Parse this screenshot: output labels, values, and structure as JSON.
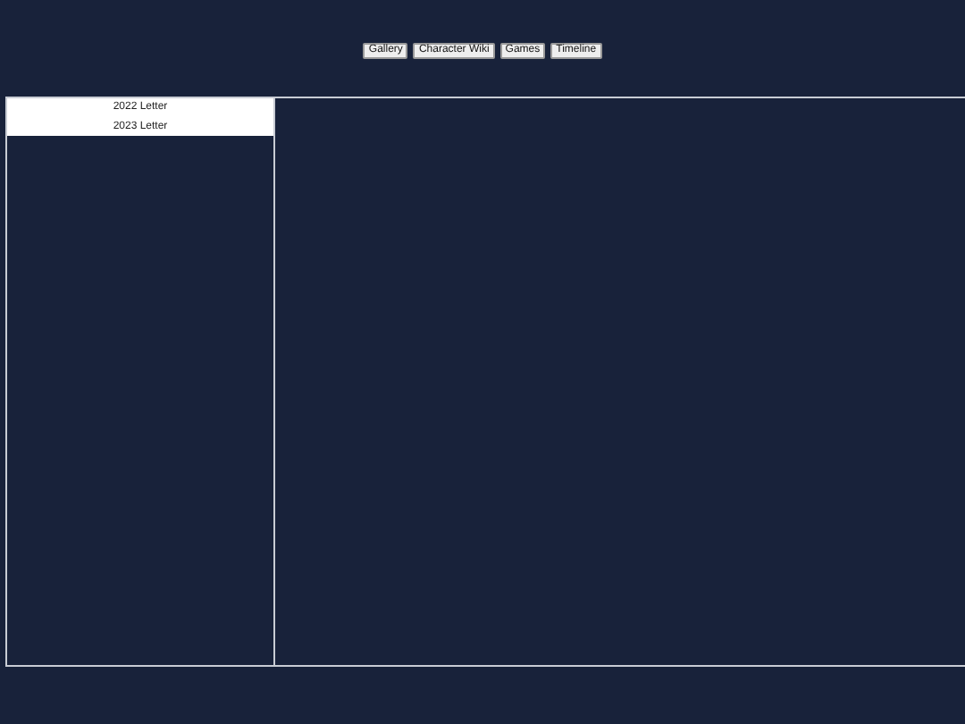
{
  "nav": {
    "buttons": [
      "Gallery",
      "Character Wiki",
      "Games",
      "Timeline"
    ]
  },
  "sidebar": {
    "items": [
      {
        "label": "2022 Letter"
      },
      {
        "label": "2023 Letter"
      }
    ]
  }
}
